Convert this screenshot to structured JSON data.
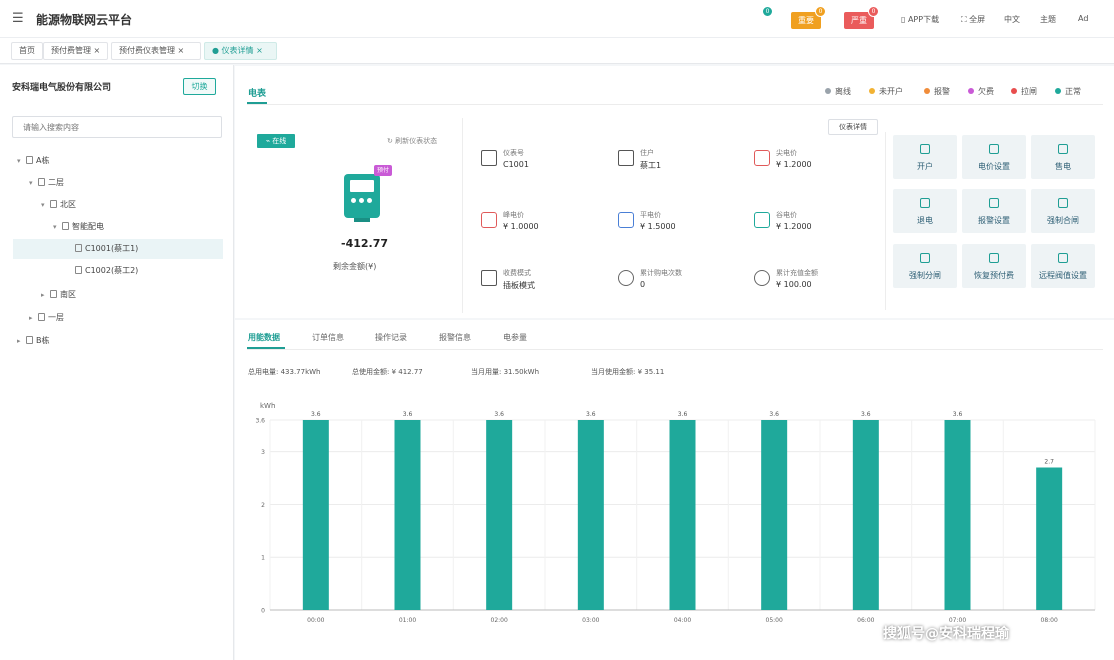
{
  "header": {
    "title": "能源物联网云平台",
    "alarms": [
      {
        "label": "一般",
        "count": "0",
        "color": "#1fa99b"
      },
      {
        "label": "重要",
        "count": "0",
        "color": "#f0a020"
      },
      {
        "label": "严重",
        "count": "0",
        "color": "#ea5b5b"
      }
    ],
    "nav": {
      "app": "APP下载",
      "fullscreen": "全屏",
      "lang": "中文",
      "theme": "主题",
      "user": "Ad"
    }
  },
  "tabs": [
    {
      "label": "首页"
    },
    {
      "label": "预付费管理"
    },
    {
      "label": "预付费仪表管理"
    },
    {
      "label": "仪表详情"
    }
  ],
  "sidebar": {
    "company": "安科瑞电气股份有限公司",
    "switch_label": "切换",
    "search_placeholder": "请输入搜索内容",
    "tree": [
      {
        "label": "A栋"
      },
      {
        "label": "二层"
      },
      {
        "label": "北区"
      },
      {
        "label": "智能配电"
      },
      {
        "label": "C1001(蔡工1)"
      },
      {
        "label": "C1002(蔡工2)"
      },
      {
        "label": "南区"
      },
      {
        "label": "一层"
      },
      {
        "label": "B栋"
      }
    ]
  },
  "info": {
    "tab": "电表",
    "legend": [
      {
        "label": "离线",
        "color": "#9aa3ab"
      },
      {
        "label": "未开户",
        "color": "#f2b233"
      },
      {
        "label": "报警",
        "color": "#f08c3a"
      },
      {
        "label": "欠费",
        "color": "#c95ad6"
      },
      {
        "label": "拉闸",
        "color": "#e84d4d"
      },
      {
        "label": "正常",
        "color": "#1fa99b"
      }
    ],
    "online": "在线",
    "refresh": "刷新仪表状态",
    "prepay_tag": "预付",
    "balance": "-412.77",
    "balance_label": "剩余金额(¥)",
    "detail_button": "仪表详情",
    "fields": [
      {
        "label": "仪表号",
        "value": "C1001"
      },
      {
        "label": "住户",
        "value": "蔡工1"
      },
      {
        "label": "尖电价",
        "value": "¥ 1.2000"
      },
      {
        "label": "峰电价",
        "value": "¥ 1.0000"
      },
      {
        "label": "平电价",
        "value": "¥ 1.5000"
      },
      {
        "label": "谷电价",
        "value": "¥ 1.2000"
      },
      {
        "label": "收费模式",
        "value": "插板模式"
      },
      {
        "label": "累计购电次数",
        "value": "0"
      },
      {
        "label": "累计充值金额",
        "value": "¥ 100.00"
      }
    ],
    "actions": [
      {
        "label": "开户"
      },
      {
        "label": "电价设置"
      },
      {
        "label": "售电"
      },
      {
        "label": "退电"
      },
      {
        "label": "报警设置"
      },
      {
        "label": "强制合闸"
      },
      {
        "label": "强制分闸"
      },
      {
        "label": "恢复预付费"
      },
      {
        "label": "远程阀值设置"
      }
    ]
  },
  "chart_tabs": [
    {
      "label": "用能数据"
    },
    {
      "label": "订单信息"
    },
    {
      "label": "操作记录"
    },
    {
      "label": "报警信息"
    },
    {
      "label": "电参量"
    }
  ],
  "stats": [
    {
      "text": "总用电量: 433.77kWh"
    },
    {
      "text": "总使用金额: ¥ 412.77"
    },
    {
      "text": "当月用量: 31.50kWh"
    },
    {
      "text": "当月使用金额: ¥ 35.11"
    }
  ],
  "chart_data": {
    "type": "bar",
    "ylabel": "kWh",
    "ylim": [
      0,
      3.6
    ],
    "yticks": [
      0,
      1,
      2,
      3,
      3.6
    ],
    "categories": [
      "00:00",
      "01:00",
      "02:00",
      "03:00",
      "04:00",
      "05:00",
      "06:00",
      "07:00",
      "08:00"
    ],
    "values": [
      3.6,
      3.6,
      3.6,
      3.6,
      3.6,
      3.6,
      3.6,
      3.6,
      2.7
    ],
    "bar_color": "#1fa99b",
    "grid": true
  },
  "watermark": "搜狐号@安科瑞程瑜"
}
